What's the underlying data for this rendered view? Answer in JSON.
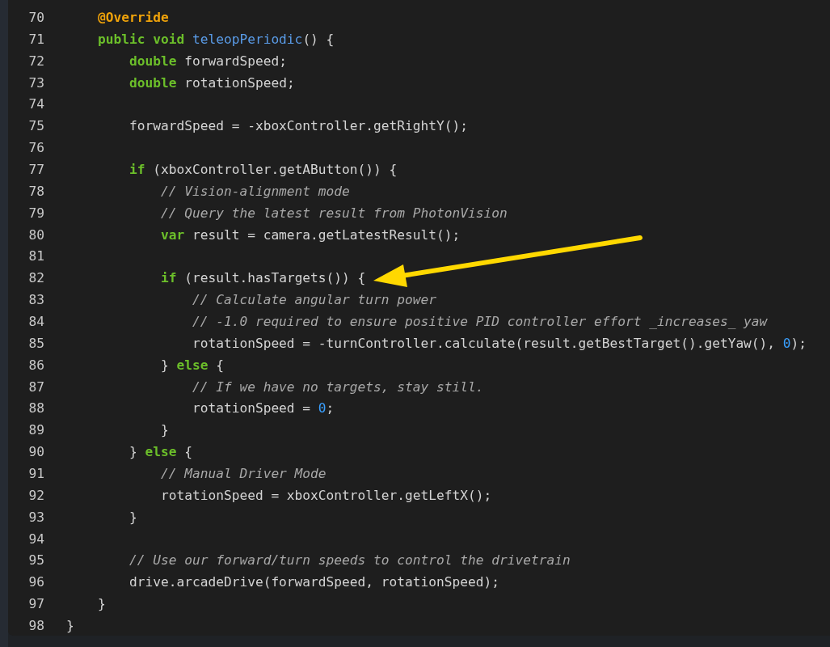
{
  "code_lines": [
    {
      "number": "70",
      "tokens": [
        {
          "kind": "annotation",
          "text": "    @Override"
        }
      ]
    },
    {
      "number": "71",
      "tokens": [
        {
          "kind": "keyword",
          "text": "    public void "
        },
        {
          "kind": "function",
          "text": "teleopPeriodic"
        },
        {
          "kind": "plain",
          "text": "() {"
        }
      ]
    },
    {
      "number": "72",
      "tokens": [
        {
          "kind": "keyword",
          "text": "        double "
        },
        {
          "kind": "plain",
          "text": "forwardSpeed;"
        }
      ]
    },
    {
      "number": "73",
      "tokens": [
        {
          "kind": "keyword",
          "text": "        double "
        },
        {
          "kind": "plain",
          "text": "rotationSpeed;"
        }
      ]
    },
    {
      "number": "74"
    },
    {
      "number": "75",
      "tokens": [
        {
          "kind": "plain",
          "text": "        forwardSpeed = -xboxController.getRightY();"
        }
      ]
    },
    {
      "number": "76"
    },
    {
      "number": "77",
      "tokens": [
        {
          "kind": "keyword",
          "text": "        if "
        },
        {
          "kind": "plain",
          "text": "(xboxController.getAButton()) {"
        }
      ]
    },
    {
      "number": "78",
      "tokens": [
        {
          "kind": "comment",
          "text": "            // Vision-alignment mode"
        }
      ]
    },
    {
      "number": "79",
      "tokens": [
        {
          "kind": "comment",
          "text": "            // Query the latest result from PhotonVision"
        }
      ]
    },
    {
      "number": "80",
      "tokens": [
        {
          "kind": "keyword",
          "text": "            var "
        },
        {
          "kind": "plain",
          "text": "result = camera.getLatestResult();"
        }
      ]
    },
    {
      "number": "81"
    },
    {
      "number": "82",
      "tokens": [
        {
          "kind": "keyword",
          "text": "            if "
        },
        {
          "kind": "plain",
          "text": "(result.hasTargets()) {"
        }
      ]
    },
    {
      "number": "83",
      "tokens": [
        {
          "kind": "comment",
          "text": "                // Calculate angular turn power"
        }
      ]
    },
    {
      "number": "84",
      "tokens": [
        {
          "kind": "comment",
          "text": "                // -1.0 required to ensure positive PID controller effort _increases_ yaw"
        }
      ]
    },
    {
      "number": "85",
      "tokens": [
        {
          "kind": "plain",
          "text": "                rotationSpeed = -turnController.calculate(result.getBestTarget().getYaw(), "
        },
        {
          "kind": "number",
          "text": "0"
        },
        {
          "kind": "plain",
          "text": ");"
        }
      ]
    },
    {
      "number": "86",
      "tokens": [
        {
          "kind": "plain",
          "text": "            } "
        },
        {
          "kind": "keyword",
          "text": "else"
        },
        {
          "kind": "plain",
          "text": " {"
        }
      ]
    },
    {
      "number": "87",
      "tokens": [
        {
          "kind": "comment",
          "text": "                // If we have no targets, stay still."
        }
      ]
    },
    {
      "number": "88",
      "tokens": [
        {
          "kind": "plain",
          "text": "                rotationSpeed = "
        },
        {
          "kind": "number",
          "text": "0"
        },
        {
          "kind": "plain",
          "text": ";"
        }
      ]
    },
    {
      "number": "89",
      "tokens": [
        {
          "kind": "plain",
          "text": "            }"
        }
      ]
    },
    {
      "number": "90",
      "tokens": [
        {
          "kind": "plain",
          "text": "        } "
        },
        {
          "kind": "keyword",
          "text": "else"
        },
        {
          "kind": "plain",
          "text": " {"
        }
      ]
    },
    {
      "number": "91",
      "tokens": [
        {
          "kind": "comment",
          "text": "            // Manual Driver Mode"
        }
      ]
    },
    {
      "number": "92",
      "tokens": [
        {
          "kind": "plain",
          "text": "            rotationSpeed = xboxController.getLeftX();"
        }
      ]
    },
    {
      "number": "93",
      "tokens": [
        {
          "kind": "plain",
          "text": "        }"
        }
      ]
    },
    {
      "number": "94"
    },
    {
      "number": "95",
      "tokens": [
        {
          "kind": "comment",
          "text": "        // Use our forward/turn speeds to control the drivetrain"
        }
      ]
    },
    {
      "number": "96",
      "tokens": [
        {
          "kind": "plain",
          "text": "        drive.arcadeDrive(forwardSpeed, rotationSpeed);"
        }
      ]
    },
    {
      "number": "97",
      "tokens": [
        {
          "kind": "plain",
          "text": "    }"
        }
      ]
    },
    {
      "number": "98",
      "tokens": [
        {
          "kind": "plain",
          "text": "}"
        }
      ]
    }
  ]
}
